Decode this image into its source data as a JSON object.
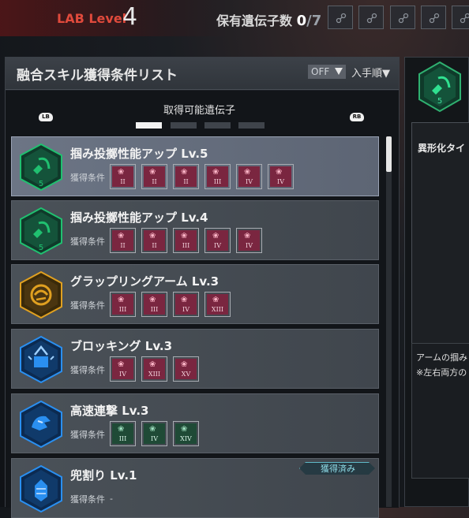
{
  "header": {
    "lab_label": "LAB Level",
    "lab_level": "4",
    "gene_label": "保有遺伝子数",
    "gene_count": "0",
    "gene_total": "/7",
    "slot_icon": "gene-slot-icon"
  },
  "panel": {
    "title": "融合スキル獲得条件リスト",
    "filter_label": "OFF",
    "sort_label": "入手順▼",
    "lb": "LB",
    "rb": "RB",
    "tab_label": "取得可能遺伝子",
    "tab_count": 4,
    "active_tab_index": 0
  },
  "skills": [
    {
      "name": "掴み投擲性能アップ Lv.5",
      "cond_label": "獲得条件",
      "icon": "grab-throw-icon",
      "icon_color": "#20c070",
      "level": "5",
      "selected": true,
      "chips": [
        {
          "color": "red",
          "rank": "II"
        },
        {
          "color": "red",
          "rank": "II"
        },
        {
          "color": "red",
          "rank": "II"
        },
        {
          "color": "red",
          "rank": "III"
        },
        {
          "color": "red",
          "rank": "IV"
        },
        {
          "color": "red",
          "rank": "IV"
        }
      ]
    },
    {
      "name": "掴み投擲性能アップ Lv.4",
      "cond_label": "獲得条件",
      "icon": "grab-throw-icon",
      "icon_color": "#20c070",
      "level": "5",
      "selected": false,
      "chips": [
        {
          "color": "red",
          "rank": "II"
        },
        {
          "color": "red",
          "rank": "II"
        },
        {
          "color": "red",
          "rank": "III"
        },
        {
          "color": "red",
          "rank": "IV"
        },
        {
          "color": "red",
          "rank": "IV"
        }
      ]
    },
    {
      "name": "グラップリングアーム Lv.3",
      "cond_label": "獲得条件",
      "icon": "grappling-arm-icon",
      "icon_color": "#e0a020",
      "level": "",
      "selected": false,
      "chips": [
        {
          "color": "red",
          "rank": "III"
        },
        {
          "color": "red",
          "rank": "III"
        },
        {
          "color": "red",
          "rank": "IV"
        },
        {
          "color": "red",
          "rank": "XIII"
        }
      ]
    },
    {
      "name": "ブロッキング Lv.3",
      "cond_label": "獲得条件",
      "icon": "blocking-icon",
      "icon_color": "#2a8ff0",
      "level": "",
      "selected": false,
      "chips": [
        {
          "color": "red",
          "rank": "IV"
        },
        {
          "color": "red",
          "rank": "XIII"
        },
        {
          "color": "red",
          "rank": "XV"
        }
      ]
    },
    {
      "name": "高速連撃 Lv.3",
      "cond_label": "獲得条件",
      "icon": "rapid-strike-icon",
      "icon_color": "#2a8ff0",
      "level": "",
      "selected": false,
      "chips": [
        {
          "color": "green",
          "rank": "III"
        },
        {
          "color": "green",
          "rank": "IV"
        },
        {
          "color": "green",
          "rank": "XIV"
        }
      ]
    },
    {
      "name": "兜割り Lv.1",
      "cond_label": "獲得条件",
      "icon": "helmet-split-icon",
      "icon_color": "#2a8ff0",
      "level": "",
      "selected": false,
      "acquired": "獲得済み",
      "cond_value": "-",
      "chips": []
    }
  ],
  "right_panel": {
    "icon": "grab-throw-icon",
    "level": "5",
    "type_text": "異形化タイ",
    "desc1": "アームの掴み",
    "desc2": "※左右両方の"
  }
}
